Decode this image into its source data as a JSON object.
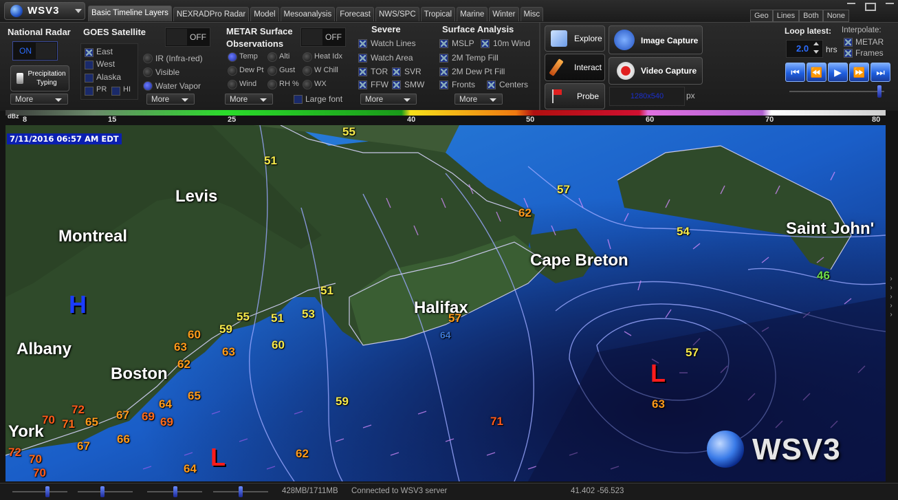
{
  "app": {
    "title": "WSV3"
  },
  "tabs": [
    {
      "label": "Basic Timeline Layers",
      "active": true
    },
    {
      "label": "NEXRADPro Radar",
      "active": false
    },
    {
      "label": "Model",
      "active": false
    },
    {
      "label": "Mesoanalysis",
      "active": false
    },
    {
      "label": "Forecast",
      "active": false
    },
    {
      "label": "NWS/SPC",
      "active": false
    },
    {
      "label": "Tropical",
      "active": false
    },
    {
      "label": "Marine",
      "active": false
    },
    {
      "label": "Winter",
      "active": false
    },
    {
      "label": "Misc",
      "active": false
    }
  ],
  "view_modes": [
    "Geo",
    "Lines",
    "Both",
    "None"
  ],
  "national_radar": {
    "title": "National Radar",
    "toggle": "ON",
    "precip_btn": "Precipitation Typing",
    "more": "More"
  },
  "goes": {
    "title": "GOES Satellite",
    "toggle": "OFF",
    "regions": [
      "East",
      "West",
      "Alaska",
      "PR",
      "HI"
    ],
    "channels": [
      "IR (Infra-red)",
      "Visible",
      "Water Vapor"
    ],
    "more": "More"
  },
  "metar": {
    "title": "METAR Surface Observations",
    "toggle": "OFF",
    "items": [
      "Temp",
      "Alti",
      "Heat Idx",
      "Dew Pt",
      "Gust",
      "W Chill",
      "Wind",
      "RH %",
      "WX"
    ],
    "large_font": "Large font",
    "more": "More"
  },
  "severe": {
    "title": "Severe",
    "items": [
      "Watch Lines",
      "Watch Area",
      "TOR",
      "SVR",
      "FFW",
      "SMW"
    ],
    "more": "More"
  },
  "surface": {
    "title": "Surface Analysis",
    "items": [
      "MSLP",
      "10m Wind",
      "2M Temp Fill",
      "2M Dew Pt Fill",
      "Fronts",
      "Centers"
    ],
    "more": "More"
  },
  "tools": {
    "explore": "Explore",
    "interact": "Interact",
    "probe": "Probe",
    "image_capture": "Image Capture",
    "video_capture": "Video Capture",
    "resolution": "1280x540",
    "px": "px"
  },
  "loop": {
    "label": "Loop latest:",
    "value": "2.0",
    "unit": "hrs",
    "interpolate_label": "Interpolate:",
    "interp_opts": [
      "METAR",
      "Frames"
    ]
  },
  "scale": {
    "unit": "dBz",
    "ticks": [
      "8",
      "15",
      "25",
      "40",
      "50",
      "60",
      "70",
      "80"
    ]
  },
  "map": {
    "timestamp": "7/11/2016 06:57 AM EDT",
    "cities": [
      "Levis",
      "Montreal",
      "Albany",
      "Boston",
      "York",
      "Halifax",
      "Cape Breton",
      "Saint John'"
    ],
    "temps": [
      "55",
      "51",
      "57",
      "62",
      "54",
      "46",
      "51",
      "55",
      "51",
      "53",
      "59",
      "60",
      "63",
      "60",
      "63",
      "62",
      "65",
      "64",
      "67",
      "69",
      "69",
      "65",
      "71",
      "70",
      "70",
      "66",
      "67",
      "72",
      "70",
      "72",
      "59",
      "71",
      "57",
      "63",
      "62",
      "64",
      "57",
      "64"
    ],
    "lows": [
      "L",
      "L"
    ],
    "high": "H",
    "watermark": "WSV3"
  },
  "status": {
    "memory": "428MB/1711MB",
    "connection": "Connected to WSV3 server",
    "coords": "41.402 -56.523"
  },
  "colors": {
    "accent": "#1f5fe0",
    "low": "#ff1c1c",
    "high": "#1a3cff",
    "temp_yellow": "#f6e94a",
    "temp_orange": "#ff9a1a"
  }
}
